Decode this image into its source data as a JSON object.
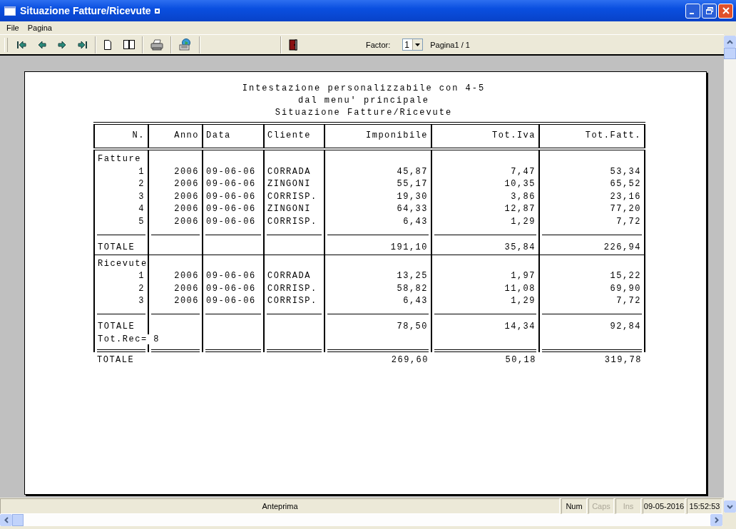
{
  "window": {
    "title": "Situazione Fatture/Ricevute"
  },
  "menu": [
    {
      "label": "File"
    },
    {
      "label": "Pagina"
    }
  ],
  "toolbar": {
    "factor_label": "Factor:",
    "factor_value": "1",
    "page_info": "Pagina1 / 1"
  },
  "report": {
    "heading": [
      "Intestazione personalizzabile con 4-5",
      "dal menu' principale",
      "Situazione Fatture/Ricevute"
    ],
    "columns": [
      "N.",
      "Anno",
      "Data",
      "Cliente",
      "Imponibile",
      "Tot.Iva",
      "Tot.Fatt."
    ],
    "sections": [
      {
        "title": "Fatture",
        "rows": [
          [
            "1",
            "2006",
            "09-06-06",
            "CORRADA",
            "45,87",
            "7,47",
            "53,34"
          ],
          [
            "2",
            "2006",
            "09-06-06",
            "ZINGONI",
            "55,17",
            "10,35",
            "65,52"
          ],
          [
            "3",
            "2006",
            "09-06-06",
            "CORRISP.",
            "19,30",
            "3,86",
            "23,16"
          ],
          [
            "4",
            "2006",
            "09-06-06",
            "ZINGONI",
            "64,33",
            "12,87",
            "77,20"
          ],
          [
            "5",
            "2006",
            "09-06-06",
            "CORRISP.",
            "6,43",
            "1,29",
            "7,72"
          ]
        ],
        "total": {
          "label": "TOTALE",
          "values": [
            "191,10",
            "35,84",
            "226,94"
          ]
        }
      },
      {
        "title": "Ricevute",
        "rows": [
          [
            "1",
            "2006",
            "09-06-06",
            "CORRADA",
            "13,25",
            "1,97",
            "15,22"
          ],
          [
            "2",
            "2006",
            "09-06-06",
            "CORRISP.",
            "58,82",
            "11,08",
            "69,90"
          ],
          [
            "3",
            "2006",
            "09-06-06",
            "CORRISP.",
            "6,43",
            "1,29",
            "7,72"
          ]
        ],
        "total": {
          "label": "TOTALE",
          "values": [
            "78,50",
            "14,34",
            "92,84"
          ]
        },
        "record_count": "Tot.Rec= 8"
      }
    ],
    "grand_total": {
      "label": "TOTALE",
      "values": [
        "269,60",
        "50,18",
        "319,78"
      ]
    }
  },
  "status_bar": {
    "message": "Anteprima",
    "indicators": [
      {
        "label": "Num",
        "disabled": false
      },
      {
        "label": "Caps",
        "disabled": true
      },
      {
        "label": "Ins",
        "disabled": true
      }
    ],
    "date": "09-05-2016",
    "time": "15:52:53"
  }
}
